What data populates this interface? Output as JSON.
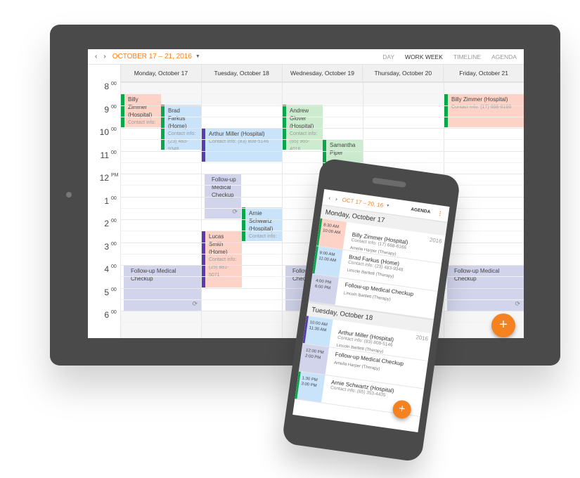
{
  "colors": {
    "accent": "#f58220",
    "device": "#4a4a4a",
    "green": "#0aa64b",
    "purple": "#5b3bb2",
    "pink": "#fdd3c8",
    "blue": "#c9e3fb",
    "lavender": "#d2d4ec",
    "light_green": "#cdeccf"
  },
  "tablet": {
    "toolbar": {
      "prev_icon": "chevron-left",
      "next_icon": "chevron-right",
      "prev": "‹",
      "next": "›",
      "range": "OCTOBER 17 – 21, 2016",
      "caret": "▼",
      "views": [
        "DAY",
        "WORK WEEK",
        "TIMELINE",
        "AGENDA"
      ],
      "active_view": "WORK WEEK"
    },
    "days": [
      "Monday, October 17",
      "Tuesday, October 18",
      "Wednesday, October 19",
      "Thursday, October 20",
      "Friday, October 21"
    ],
    "hours": [
      {
        "h": "8",
        "m": "00"
      },
      {
        "h": "9",
        "m": "00"
      },
      {
        "h": "10",
        "m": "00"
      },
      {
        "h": "11",
        "m": "00"
      },
      {
        "h": "12",
        "m": "PM"
      },
      {
        "h": "1",
        "m": "00"
      },
      {
        "h": "2",
        "m": "00"
      },
      {
        "h": "3",
        "m": "00"
      },
      {
        "h": "4",
        "m": "00"
      },
      {
        "h": "5",
        "m": "00"
      },
      {
        "h": "6",
        "m": "00"
      }
    ],
    "events": [
      {
        "title": "Billy Zimmer (Hospital)",
        "contact": "Contact info:"
      },
      {
        "title": "Brad Farkus (Home)",
        "contact": "Contact info: (23) 483-9348"
      },
      {
        "title": "Follow-up Medical Checkup",
        "contact": ""
      },
      {
        "title": "Arthur Miller (Hospital)",
        "contact": "Contact info: (83) 808-5146"
      },
      {
        "title": "Follow-up Medical Checkup",
        "contact": ""
      },
      {
        "title": "Arnie Schwartz (Hospital)",
        "contact": "Contact info:"
      },
      {
        "title": "Lucas Smith (Home)",
        "contact": "Contact info: (25) 881-5071"
      },
      {
        "title": "Andrew Glover (Hospital)",
        "contact": "Contact info: (65) 965-4016"
      },
      {
        "title": "Samantha Piper",
        "contact": ""
      },
      {
        "title": "Follow-up Medical Checkup",
        "contact": ""
      },
      {
        "title": "Billy Zimmer (Hospital)",
        "contact": "Contact info: (17) 668-6166"
      },
      {
        "title": "Follow-up Medical Checkup",
        "contact": ""
      }
    ],
    "fab": "+"
  },
  "phone": {
    "toolbar": {
      "prev": "‹",
      "next": "›",
      "range": "OCT 17 – 20, 16",
      "caret": "▼",
      "view": "AGENDA",
      "more": "⋮"
    },
    "groups": [
      {
        "day": "Monday, October 17",
        "year": "2016",
        "items": [
          {
            "start": "8:30 AM",
            "end": "10:00 AM",
            "title": "Billy Zimmer (Hospital)",
            "contact": "Contact info: (17) 668-6166",
            "resource": "Amelia Harper (Therapy)"
          },
          {
            "start": "9:00 AM",
            "end": "11:00 AM",
            "title": "Brad Farkus (Home)",
            "contact": "Contact info: (23) 483-9348",
            "resource": "Lincoln Bartlett (Therapy)"
          },
          {
            "start": "4:00 PM",
            "end": "6:00 PM",
            "title": "Follow-up Medical Checkup",
            "contact": "",
            "resource": "Lincoln Bartlett (Therapy)"
          }
        ]
      },
      {
        "day": "Tuesday, October 18",
        "year": "2016",
        "items": [
          {
            "start": "10:00 AM",
            "end": "11:30 AM",
            "title": "Arthur Miller (Hospital)",
            "contact": "Contact info: (83) 808-5146",
            "resource": "Lincoln Bartlett (Therapy)"
          },
          {
            "start": "12:00 PM",
            "end": "2:00 PM",
            "title": "Follow-up Medical Checkup",
            "contact": "",
            "resource": "Amelia Harper (Therapy)"
          },
          {
            "start": "1:30 PM",
            "end": "3:00 PM",
            "title": "Arnie Schwartz (Hospital)",
            "contact": "Contact info: (65) 353-4435",
            "resource": ""
          }
        ]
      }
    ],
    "fab": "+"
  }
}
